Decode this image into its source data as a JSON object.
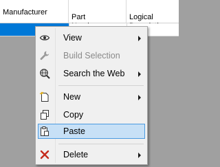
{
  "grid": {
    "columns": [
      {
        "label": "Manufacturer"
      },
      {
        "label": "Part\nNumber"
      },
      {
        "label": "Logical\nDescription"
      }
    ]
  },
  "context_menu": {
    "items": [
      {
        "label": "View",
        "icon": "eye-icon",
        "submenu": true,
        "enabled": true
      },
      {
        "label": "Build Selection",
        "icon": "wrench-icon",
        "submenu": false,
        "enabled": false
      },
      {
        "label": "Search the Web",
        "icon": "globe-search-icon",
        "submenu": true,
        "enabled": true
      },
      {
        "label": "New",
        "icon": "new-document-icon",
        "submenu": true,
        "enabled": true
      },
      {
        "label": "Copy",
        "icon": "copy-icon",
        "submenu": false,
        "enabled": true
      },
      {
        "label": "Paste",
        "icon": "paste-icon",
        "submenu": false,
        "enabled": true,
        "highlighted": true
      },
      {
        "label": "Delete",
        "icon": "delete-x-icon",
        "submenu": true,
        "enabled": true
      }
    ]
  },
  "colors": {
    "selection": "#0078d7",
    "menu_background": "#f0f0f0",
    "highlight_fill": "#c7e0f6",
    "highlight_border": "#4a9ae0",
    "delete_red": "#c42b1c",
    "desktop": "#a0a0a0"
  }
}
